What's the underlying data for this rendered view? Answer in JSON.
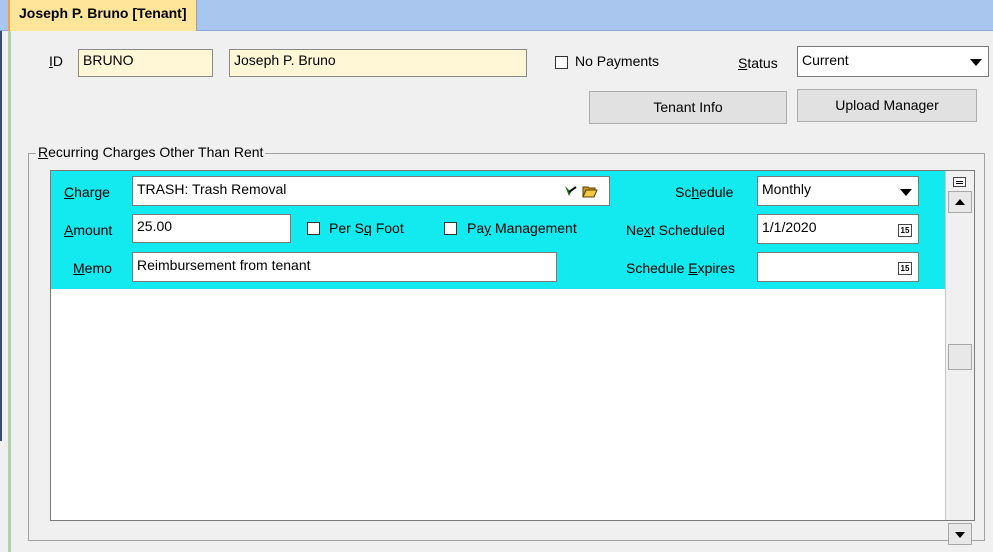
{
  "window": {
    "title": "Joseph P. Bruno  [Tenant]"
  },
  "header": {
    "id_label": "ID",
    "id_value": "BRUNO",
    "name_value": "Joseph P. Bruno",
    "no_payments_label": "No Payments",
    "status_label": "Status",
    "status_value": "Current",
    "tenant_info_button": "Tenant Info",
    "upload_manager_button": "Upload Manager"
  },
  "recurring": {
    "group_title": "Recurring Charges Other Than Rent",
    "charge_label": "Charge",
    "charge_value": "TRASH: Trash Removal",
    "amount_label": "Amount",
    "amount_value": "25.00",
    "per_sq_foot_label": "Per Sq Foot",
    "pay_management_label": "Pay Management",
    "memo_label": "Memo",
    "memo_value": "Reimbursement from tenant",
    "schedule_label": "Schedule",
    "schedule_value": "Monthly",
    "next_scheduled_label": "Next Scheduled",
    "next_scheduled_value": "1/1/2020",
    "schedule_expires_label": "Schedule Expires",
    "schedule_expires_value": "",
    "calendar_glyph": "15"
  },
  "icons": [
    "dropdown-arrow-icon",
    "pick-icon",
    "folder-open-icon",
    "calendar-icon",
    "scroll-up-icon",
    "scroll-down-icon",
    "record-nav-icon"
  ],
  "colors": {
    "titlebar": "#a9c6ee",
    "tab": "#ffe59a",
    "highlight_row": "#12eaf0",
    "id_field": "#fff7d6"
  }
}
